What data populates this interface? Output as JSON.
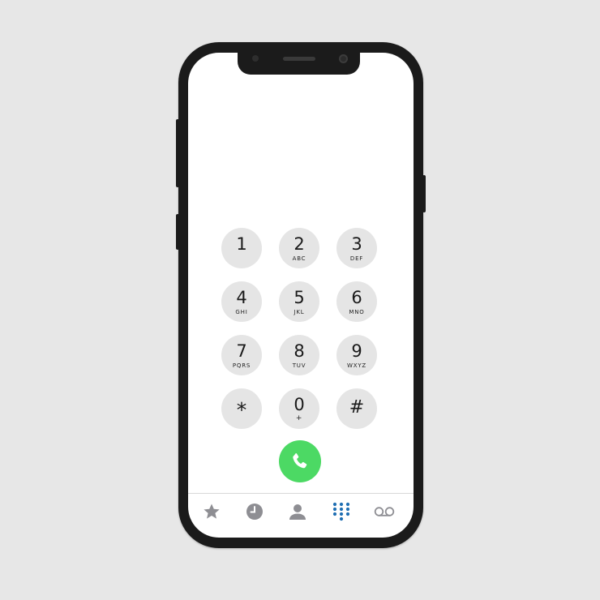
{
  "colors": {
    "background": "#e7e7e7",
    "phone_frame": "#1b1b1b",
    "key_background": "#e5e5e5",
    "call_green": "#4cd964",
    "tab_inactive": "#8e8e93",
    "tab_active": "#1f6fb3"
  },
  "keypad": {
    "keys": [
      {
        "digit": "1",
        "letters": ""
      },
      {
        "digit": "2",
        "letters": "ABC"
      },
      {
        "digit": "3",
        "letters": "DEF"
      },
      {
        "digit": "4",
        "letters": "GHI"
      },
      {
        "digit": "5",
        "letters": "JKL"
      },
      {
        "digit": "6",
        "letters": "MNO"
      },
      {
        "digit": "7",
        "letters": "PQRS"
      },
      {
        "digit": "8",
        "letters": "TUV"
      },
      {
        "digit": "9",
        "letters": "WXYZ"
      },
      {
        "digit": "*",
        "letters": ""
      },
      {
        "digit": "0",
        "letters": "+"
      },
      {
        "digit": "#",
        "letters": ""
      }
    ]
  },
  "call_button": {
    "icon": "phone-icon"
  },
  "tabbar": {
    "tabs": [
      {
        "icon": "star-icon",
        "active": false
      },
      {
        "icon": "clock-icon",
        "active": false
      },
      {
        "icon": "person-icon",
        "active": false
      },
      {
        "icon": "keypad-grid-icon",
        "active": true
      },
      {
        "icon": "voicemail-icon",
        "active": false
      }
    ]
  }
}
